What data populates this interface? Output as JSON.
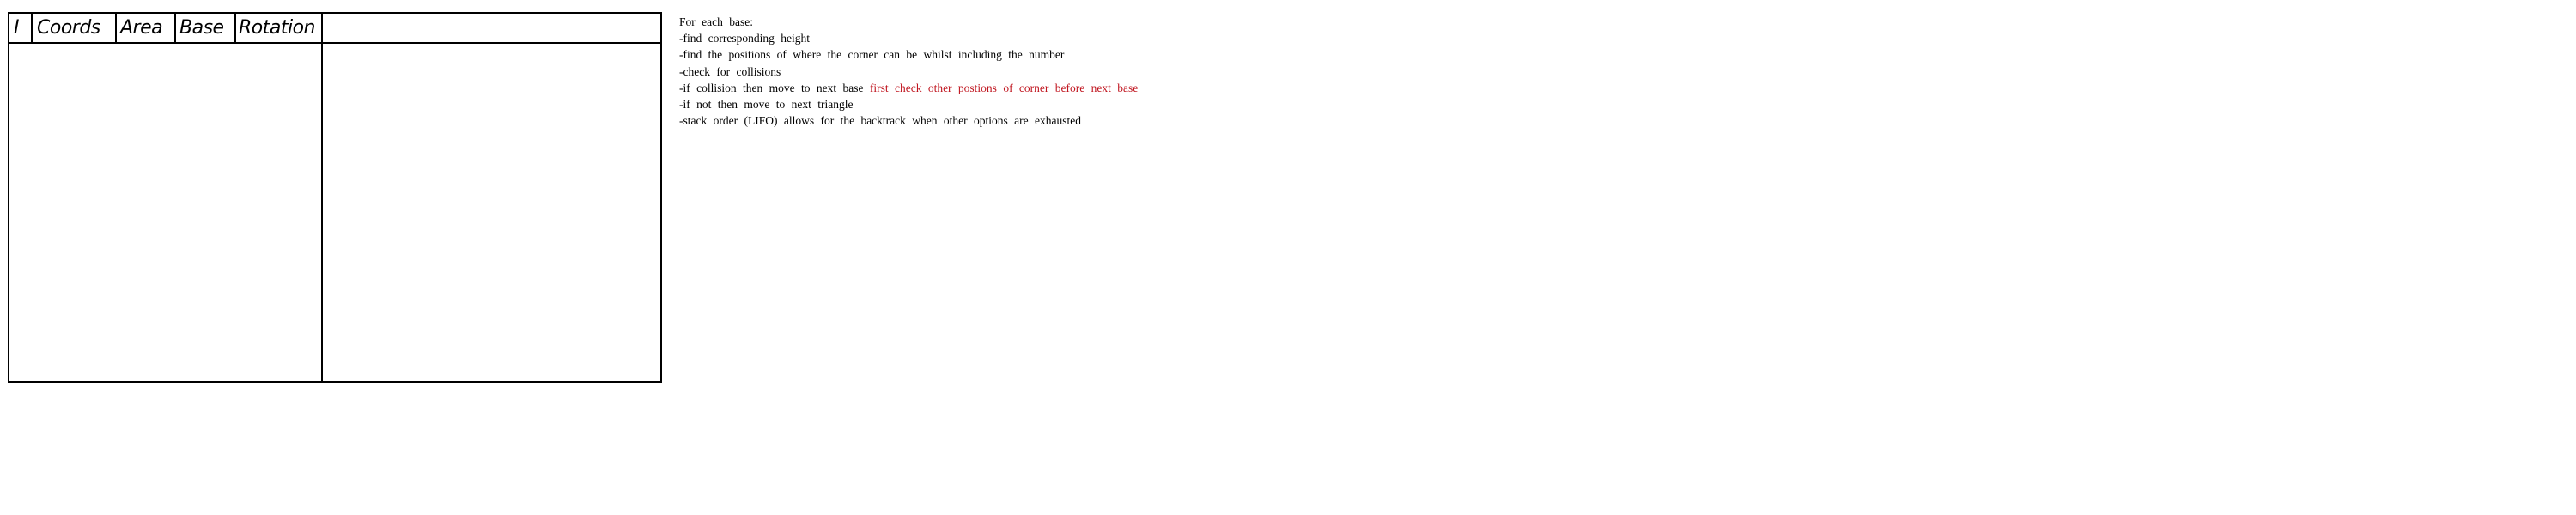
{
  "table": {
    "headers": [
      "I",
      "Coords",
      "Area",
      "Base",
      "Rotation"
    ]
  },
  "notes": {
    "heading": "For each base:",
    "lines": [
      "-find corresponding height",
      "-find the positions of where the corner can be whilst including the number",
      "-check for collisions",
      "-if collision then move to next base",
      "-if not then move to next triangle",
      "-stack order (LIFO) allows for the backtrack when other options are exhausted"
    ],
    "annotation": "first check other postions of corner before next base",
    "annotation_color": "#c0151f"
  }
}
